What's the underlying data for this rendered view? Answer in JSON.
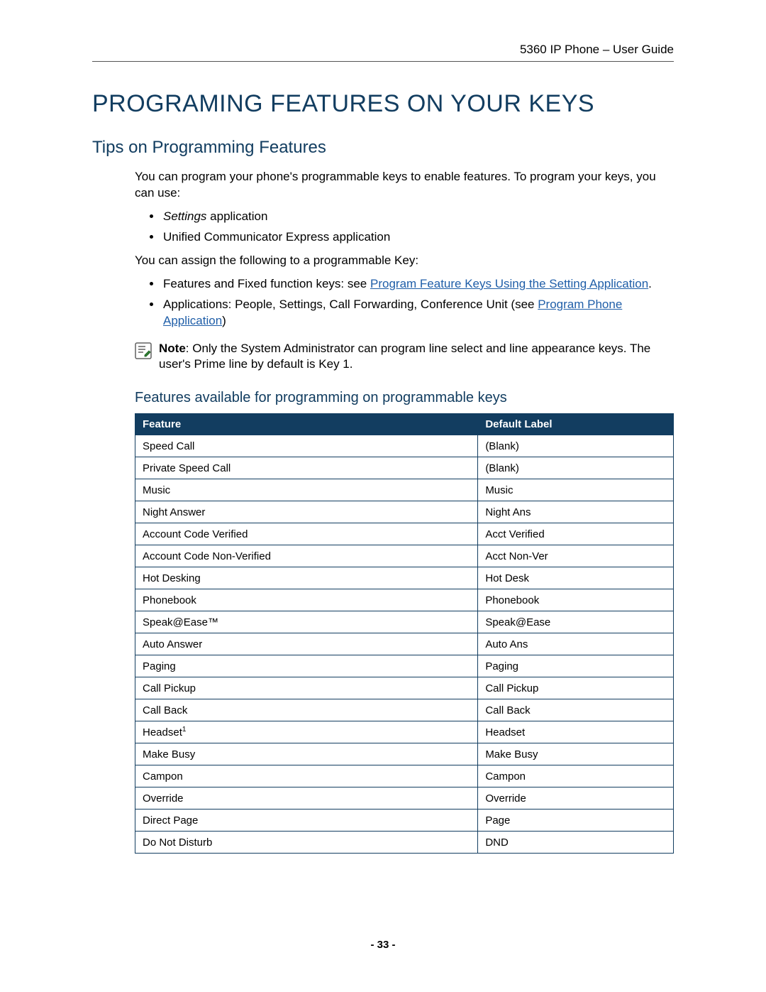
{
  "header": "5360 IP Phone – User Guide",
  "title": "PROGRAMING FEATURES ON YOUR KEYS",
  "section_title": "Tips on Programming Features",
  "intro": "You can program your phone's programmable keys to enable features. To program your keys, you can use:",
  "bullets1_pre_italic": "Settings",
  "bullets1_post": " application",
  "bullets1_item2": "Unified Communicator Express application",
  "assign_intro": "You can assign the following to a programmable Key:",
  "bullets2_item1_pre": "Features and Fixed function keys: see ",
  "bullets2_item1_link": "Program Feature Keys Using the Setting Application",
  "bullets2_item1_post": ".",
  "bullets2_item2_pre": "Applications: People, Settings, Call Forwarding, Conference Unit (see ",
  "bullets2_item2_link": "Program Phone Application",
  "bullets2_item2_post": ")",
  "note_label": "Note",
  "note_text": ": Only the System Administrator can program line select and line appearance keys. The user's Prime line by default is Key 1.",
  "table_title": "Features available for programming on programmable keys",
  "table_headers": {
    "c1": "Feature",
    "c2": "Default Label"
  },
  "rows": [
    {
      "f": "Speed Call",
      "d": "(Blank)"
    },
    {
      "f": "Private Speed Call",
      "d": "(Blank)"
    },
    {
      "f": "Music",
      "d": "Music"
    },
    {
      "f": "Night Answer",
      "d": "Night Ans"
    },
    {
      "f": "Account Code Verified",
      "d": "Acct Verified"
    },
    {
      "f": "Account Code Non-Verified",
      "d": "Acct Non-Ver"
    },
    {
      "f": "Hot Desking",
      "d": "Hot Desk"
    },
    {
      "f": "Phonebook",
      "d": "Phonebook"
    },
    {
      "f": "Speak@Ease™",
      "d": "Speak@Ease"
    },
    {
      "f": "Auto Answer",
      "d": "Auto Ans"
    },
    {
      "f": "Paging",
      "d": "Paging"
    },
    {
      "f": "Call Pickup",
      "d": "Call Pickup"
    },
    {
      "f": "Call Back",
      "d": "Call Back"
    },
    {
      "f": "Headset",
      "sup": "1",
      "d": "Headset"
    },
    {
      "f": "Make Busy",
      "d": "Make Busy"
    },
    {
      "f": "Campon",
      "d": "Campon"
    },
    {
      "f": "Override",
      "d": "Override"
    },
    {
      "f": "Direct Page",
      "d": "Page"
    },
    {
      "f": "Do Not Disturb",
      "d": "DND"
    }
  ],
  "page_number": "- 33 -"
}
